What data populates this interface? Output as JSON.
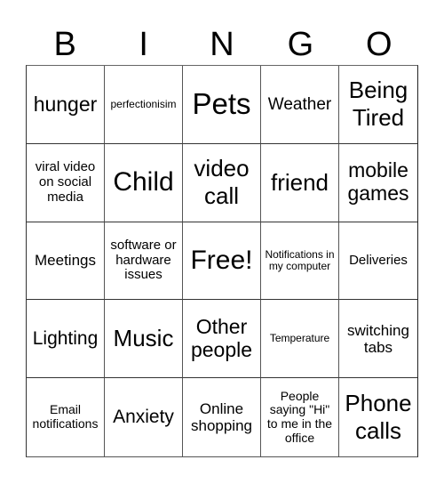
{
  "header": [
    "B",
    "I",
    "N",
    "G",
    "O"
  ],
  "cells": [
    "hunger",
    "perfectionisim",
    "Pets",
    "Weather",
    "Being Tired",
    "viral video on social media",
    "Child",
    "video call",
    "friend",
    "mobile games",
    "Meetings",
    "software or hardware issues",
    "Free!",
    "Notifications in my computer",
    "Deliveries",
    "Lighting",
    "Music",
    "Other people",
    "Temperature",
    "switching tabs",
    "Email notifications",
    "Anxiety",
    "Online shopping",
    "People saying \"Hi\" to me in the office",
    "Phone calls"
  ]
}
